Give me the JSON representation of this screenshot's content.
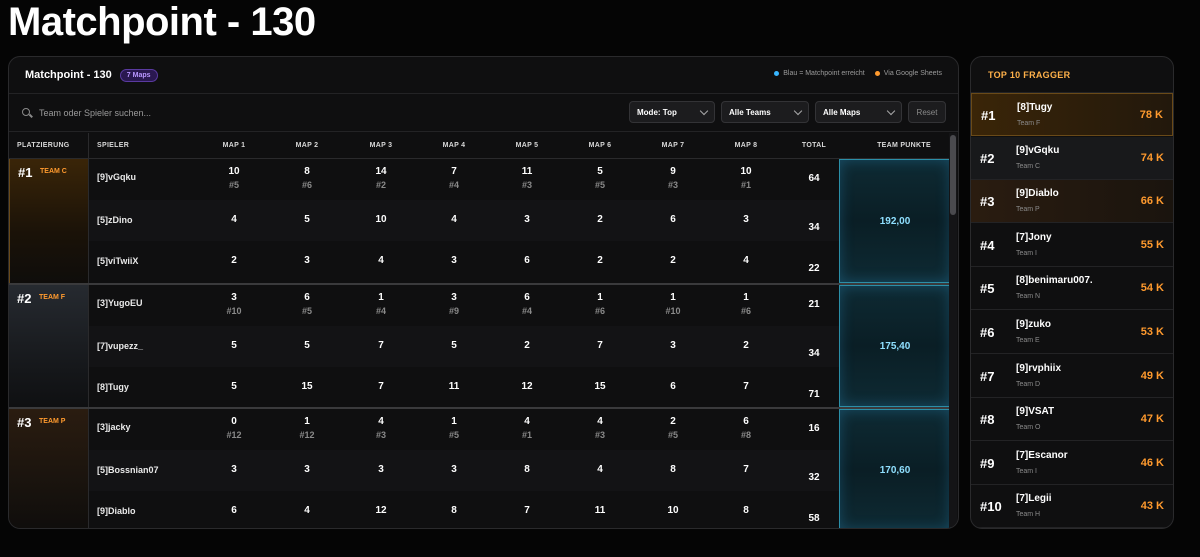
{
  "page_title": "Matchpoint - 130",
  "panel": {
    "title": "Matchpoint - 130",
    "maps_badge": "7 Maps",
    "legend_blue": "Blau = Matchpoint erreicht",
    "legend_orange": "Via Google Sheets"
  },
  "filters": {
    "search_placeholder": "Team oder Spieler suchen...",
    "mode": "Mode: Top",
    "teams": "Alle Teams",
    "maps": "Alle Maps",
    "reset": "Reset"
  },
  "colors": {
    "accent_orange": "#ff9a2e",
    "accent_blue": "#38b6ff",
    "badge_purple": "#b996ff"
  },
  "table": {
    "headers": {
      "rank": "PLATZIERUNG",
      "player": "SPIELER",
      "maps": [
        "MAP 1",
        "MAP 2",
        "MAP 3",
        "MAP 4",
        "MAP 5",
        "MAP 6",
        "MAP 7",
        "MAP 8"
      ],
      "total": "TOTAL",
      "team_points": "TEAM PUNKTE"
    },
    "teams": [
      {
        "rank": "#1",
        "team": "TEAM C",
        "points": "192,00",
        "players": [
          {
            "name": "[9]vGqku",
            "maps": [
              "10",
              "8",
              "14",
              "7",
              "11",
              "5",
              "9",
              "10"
            ],
            "ranks": [
              "#5",
              "#6",
              "#2",
              "#4",
              "#3",
              "#5",
              "#3",
              "#1"
            ],
            "total": "64"
          },
          {
            "name": "[5]zDino",
            "maps": [
              "4",
              "5",
              "10",
              "4",
              "3",
              "2",
              "6",
              "3"
            ],
            "ranks": [
              "",
              "",
              "",
              "",
              "",
              "",
              "",
              ""
            ],
            "total": "34"
          },
          {
            "name": "[5]viTwiiX",
            "maps": [
              "2",
              "3",
              "4",
              "3",
              "6",
              "2",
              "2",
              "4"
            ],
            "ranks": [
              "",
              "",
              "",
              "",
              "",
              "",
              "",
              ""
            ],
            "total": "22"
          }
        ]
      },
      {
        "rank": "#2",
        "team": "TEAM F",
        "points": "175,40",
        "players": [
          {
            "name": "[3]YugoEU",
            "maps": [
              "3",
              "6",
              "1",
              "3",
              "6",
              "1",
              "1",
              "1"
            ],
            "ranks": [
              "#10",
              "#5",
              "#4",
              "#9",
              "#4",
              "#6",
              "#10",
              "#6"
            ],
            "total": "21"
          },
          {
            "name": "[7]vupezz_",
            "maps": [
              "5",
              "5",
              "7",
              "5",
              "2",
              "7",
              "3",
              "2"
            ],
            "ranks": [
              "",
              "",
              "",
              "",
              "",
              "",
              "",
              ""
            ],
            "total": "34"
          },
          {
            "name": "[8]Tugy",
            "maps": [
              "5",
              "15",
              "7",
              "11",
              "12",
              "15",
              "6",
              "7"
            ],
            "ranks": [
              "",
              "",
              "",
              "",
              "",
              "",
              "",
              ""
            ],
            "total": "71"
          }
        ]
      },
      {
        "rank": "#3",
        "team": "TEAM P",
        "points": "170,60",
        "players": [
          {
            "name": "[3]jacky",
            "maps": [
              "0",
              "1",
              "4",
              "1",
              "4",
              "4",
              "2",
              "6"
            ],
            "ranks": [
              "#12",
              "#12",
              "#3",
              "#5",
              "#1",
              "#3",
              "#5",
              "#8"
            ],
            "total": "16"
          },
          {
            "name": "[5]Bossnian07",
            "maps": [
              "3",
              "3",
              "3",
              "3",
              "8",
              "4",
              "8",
              "7"
            ],
            "ranks": [
              "",
              "",
              "",
              "",
              "",
              "",
              "",
              ""
            ],
            "total": "32"
          },
          {
            "name": "[9]Diablo",
            "maps": [
              "6",
              "4",
              "12",
              "8",
              "7",
              "11",
              "10",
              "8"
            ],
            "ranks": [
              "",
              "",
              "",
              "",
              "",
              "",
              "",
              ""
            ],
            "total": "58"
          }
        ]
      }
    ]
  },
  "top_fraggers": {
    "title": "TOP 10 FRAGGER",
    "items": [
      {
        "rank": "#1",
        "name": "[8]Tugy",
        "team": "Team F",
        "value": "78 K"
      },
      {
        "rank": "#2",
        "name": "[9]vGqku",
        "team": "Team C",
        "value": "74 K"
      },
      {
        "rank": "#3",
        "name": "[9]Diablo",
        "team": "Team P",
        "value": "66 K"
      },
      {
        "rank": "#4",
        "name": "[7]Jony",
        "team": "Team I",
        "value": "55 K"
      },
      {
        "rank": "#5",
        "name": "[8]benimaru007.",
        "team": "Team N",
        "value": "54 K"
      },
      {
        "rank": "#6",
        "name": "[9]zuko",
        "team": "Team E",
        "value": "53 K"
      },
      {
        "rank": "#7",
        "name": "[9]rvphiix",
        "team": "Team D",
        "value": "49 K"
      },
      {
        "rank": "#8",
        "name": "[9]VSAT",
        "team": "Team O",
        "value": "47 K"
      },
      {
        "rank": "#9",
        "name": "[7]Escanor",
        "team": "Team I",
        "value": "46 K"
      },
      {
        "rank": "#10",
        "name": "[7]Legii",
        "team": "Team H",
        "value": "43 K"
      }
    ]
  }
}
